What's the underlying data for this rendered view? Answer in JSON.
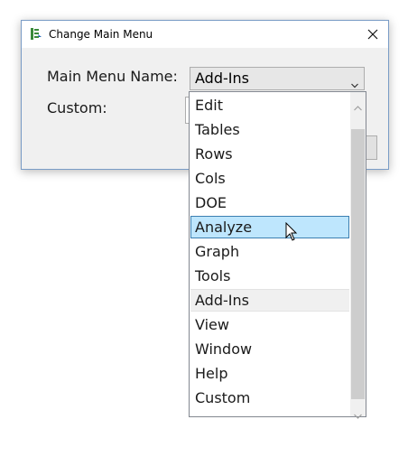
{
  "window": {
    "title": "Change Main Menu",
    "icon": "jmp-menu-icon",
    "close_glyph": "✕"
  },
  "form": {
    "main_menu_label": "Main Menu Name:",
    "main_menu_value": "Add-Ins",
    "custom_label": "Custom:"
  },
  "dropdown": {
    "items": [
      "Edit",
      "Tables",
      "Rows",
      "Cols",
      "DOE",
      "Analyze",
      "Graph",
      "Tools",
      "Add-Ins",
      "View",
      "Window",
      "Help",
      "Custom"
    ],
    "hovered_item": "Analyze",
    "current_item": "Add-Ins"
  },
  "colors": {
    "hover_fill": "#bee6fd",
    "hover_border": "#3c7fb1",
    "window_border": "#7a9cc6",
    "dialog_bg": "#f0f0f0"
  }
}
